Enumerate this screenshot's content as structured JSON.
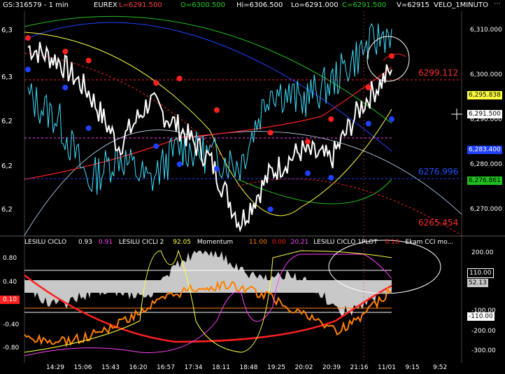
{
  "header": {
    "symbol": "GS:316579 - 1 min",
    "exchange": "EUREX",
    "low": "L=6291.500",
    "open": "O=6300.500",
    "high": "Hi=6306.500",
    "lo": "Lo=6291.000",
    "close": "C=6291.500",
    "volume": "V=62915",
    "study": "VELO_1MINUTO"
  },
  "price_axis": {
    "ticks": [
      "6,310.000",
      "6,300.000",
      "6,290.000",
      "6,280.000",
      "6,270.000"
    ],
    "left_ticks": [
      "6,3",
      "6,3",
      "6,2",
      "6,2",
      "6,2"
    ],
    "boxes": {
      "yellow": "6,295.838",
      "white": "6,291.500",
      "blue": "6,283.400",
      "green": "6,276.861"
    }
  },
  "levels": {
    "red_upper": "6299.112",
    "blue_mid": "6276.996",
    "red_lower": "6265.454"
  },
  "osc_header": {
    "ind1_name": "LESILU CICLO",
    "ind1_val1": "0.93",
    "ind1_val2": "0.91",
    "ind2_name": "LESILU CICLI 2",
    "ind2_val": "92.05",
    "ind3_name": "Momentum",
    "ind3_val1": "11.00",
    "ind3_val2": "0.00",
    "ind3_val3": "20.21",
    "ind4_name": "LESILU CICLO 1PLOT",
    "ind4_val": "0.10",
    "ind5_name": "Ekam CCI mo..."
  },
  "osc_axis": {
    "left_ticks": [
      "0.80",
      "0.40",
      "0.10",
      "-0.40",
      "-0.80"
    ],
    "right_ticks": [
      "200.00",
      "110.00",
      "52.13",
      "-100.00",
      "-110.00",
      "-200.00",
      "-300.00"
    ]
  },
  "time_axis": [
    "14:29",
    "15:06",
    "15:43",
    "16:20",
    "16:57",
    "17:34",
    "18:11",
    "18:48",
    "19:25",
    "20:02",
    "20:39",
    "21:16",
    "11/01",
    "9:15",
    "9:52"
  ],
  "colors": {
    "price_line": "#ffffff",
    "velo_line": "#40e0ff",
    "red_line": "#ff2020",
    "green_line": "#20c020",
    "yellow_line": "#ffff40",
    "blue_line": "#2040ff",
    "orange_line": "#ff8000",
    "magenta_line": "#ff40ff"
  },
  "chart_data": {
    "type": "line",
    "title": "",
    "x": [
      "14:29",
      "15:06",
      "15:43",
      "16:20",
      "16:57",
      "17:34",
      "18:11",
      "18:48",
      "19:25",
      "20:02",
      "20:39",
      "21:16",
      "11/01"
    ],
    "series": [
      {
        "values": [
          6306,
          6303,
          6296,
          6284,
          6294,
          6288,
          6281,
          6267,
          6278,
          6283,
          6281,
          6293,
          6301
        ]
      },
      {
        "values": [
          6295,
          6290,
          6276,
          6282,
          6276,
          6284,
          6282,
          6280,
          6297,
          6294,
          6298,
          6305,
          6310
        ]
      }
    ],
    "markers": {
      "red_dots": [
        [
          0,
          6308
        ],
        [
          1,
          6305
        ],
        [
          2,
          6303
        ],
        [
          4,
          6298
        ],
        [
          5,
          6299
        ],
        [
          6,
          6292
        ],
        [
          8,
          6287
        ],
        [
          9,
          6285
        ],
        [
          10,
          6290
        ],
        [
          11,
          6297
        ],
        [
          12,
          6304
        ]
      ],
      "blue_dots": [
        [
          0,
          6301
        ],
        [
          1,
          6297
        ],
        [
          2,
          6288
        ],
        [
          4,
          6284
        ],
        [
          5,
          6280
        ],
        [
          6,
          6279
        ],
        [
          8,
          6270
        ],
        [
          9,
          6278
        ],
        [
          10,
          6277
        ],
        [
          11,
          6289
        ],
        [
          12,
          6290
        ]
      ]
    },
    "ylim": [
      6265,
      6313
    ]
  }
}
